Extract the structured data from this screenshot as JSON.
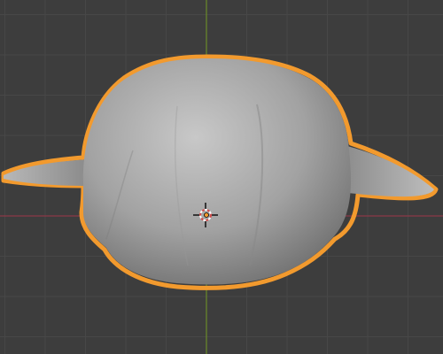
{
  "viewport": {
    "view": "3d-viewport",
    "colors": {
      "background": "#3d3d3d",
      "grid_line": "#474747",
      "axis_x": "#8b3a47",
      "axis_y": "#6a8a2a",
      "selection_outline": "#f29a2e",
      "mesh": "#9a9a9a",
      "cursor_ring_red": "#d24a4a",
      "cursor_ring_white": "#ffffff"
    },
    "selected_object": {
      "selection_state": "selected",
      "shading": "solid"
    },
    "icons": {
      "cursor": "3d-cursor-icon",
      "origin": "object-origin-icon"
    }
  }
}
